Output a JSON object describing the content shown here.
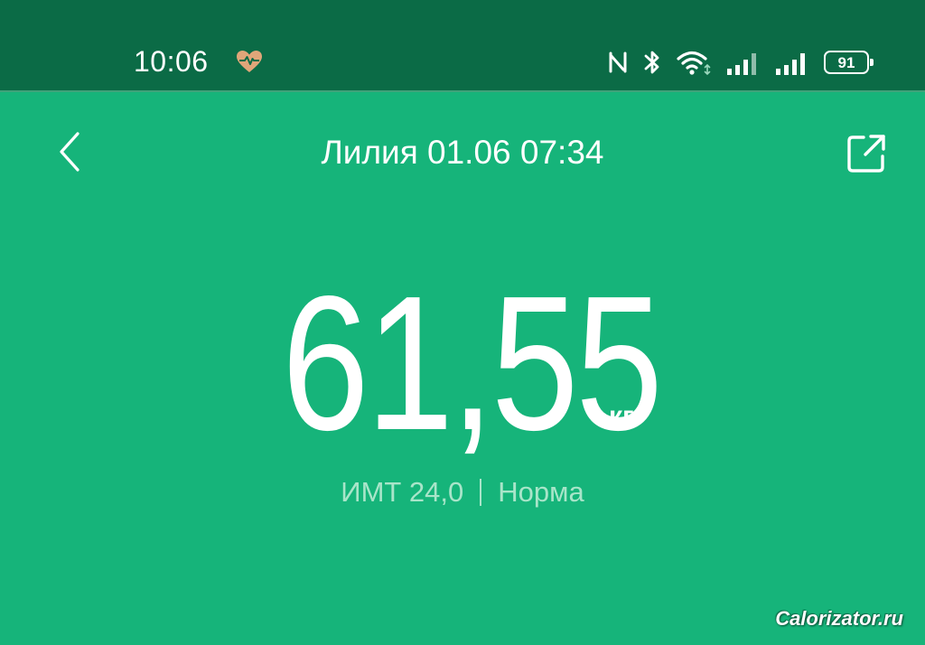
{
  "status_bar": {
    "time": "10:06",
    "battery_level": "91",
    "icons": [
      "heart-rate-icon",
      "nfc-icon",
      "bluetooth-icon",
      "wifi-icon",
      "signal-icon",
      "signal-icon",
      "battery-icon"
    ]
  },
  "header": {
    "title": "Лилия 01.06 07:34",
    "back_icon": "chevron-left-icon",
    "share_icon": "share-icon"
  },
  "measurement": {
    "weight": "61,55",
    "unit": "кг",
    "bmi_label": "ИМТ 24,0",
    "bmi_status": "Норма"
  },
  "watermark": "Calorizator.ru",
  "colors": {
    "background": "#16b47a",
    "status_bar": "#0b6b46",
    "heart": "#e0a679",
    "secondary_text": "#a8e5c9"
  }
}
